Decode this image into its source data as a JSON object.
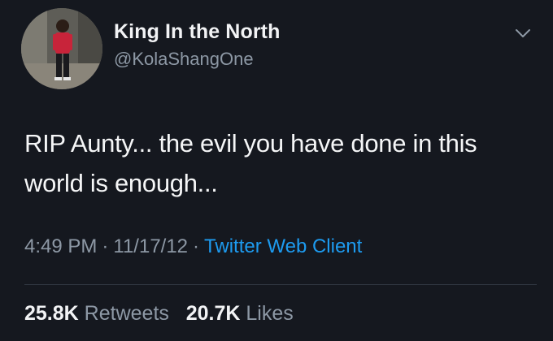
{
  "user": {
    "display_name": "King In the North",
    "handle": "@KolaShangOne",
    "avatar_icon": "profile-photo"
  },
  "tweet": {
    "text": "RIP Aunty... the evil you have done in this world is enough..."
  },
  "meta": {
    "time": "4:49 PM",
    "date": "11/17/12",
    "separator": "·",
    "source": "Twitter Web Client"
  },
  "stats": {
    "retweets_count": "25.8K",
    "retweets_label": "Retweets",
    "likes_count": "20.7K",
    "likes_label": "Likes"
  },
  "colors": {
    "background": "#15181f",
    "accent": "#1d9bf0",
    "muted": "#8d98a5"
  }
}
